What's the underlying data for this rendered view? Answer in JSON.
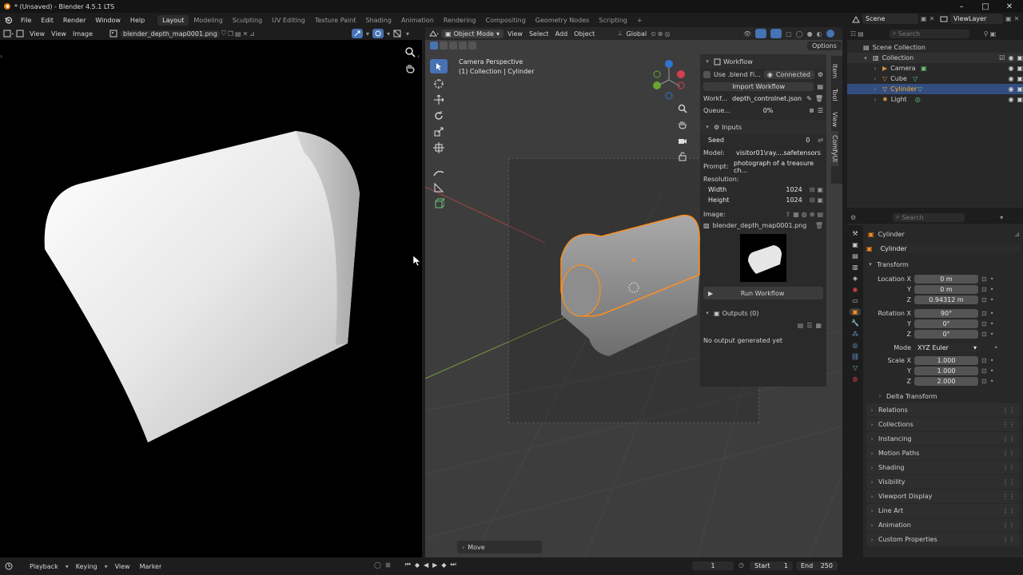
{
  "window": {
    "title": "* (Unsaved) - Blender 4.5.1 LTS",
    "min": "–",
    "max": "□",
    "close": "✕"
  },
  "menu": {
    "items": [
      "File",
      "Edit",
      "Render",
      "Window",
      "Help"
    ]
  },
  "workspaces": [
    "Layout",
    "Modeling",
    "Sculpting",
    "UV Editing",
    "Texture Paint",
    "Shading",
    "Animation",
    "Rendering",
    "Compositing",
    "Geometry Nodes",
    "Scripting",
    "+"
  ],
  "image_editor": {
    "view": "View",
    "view2": "View",
    "image": "Image",
    "filename": "blender_depth_map0001.png"
  },
  "viewport": {
    "mode": "Object Mode",
    "menus": [
      "View",
      "Select",
      "Add",
      "Object"
    ],
    "orientation": "Global",
    "overlay_title": "Camera Perspective",
    "overlay_sub": "(1) Collection | Cylinder",
    "options": "Options",
    "last_op": "Move",
    "side_tabs": [
      "Item",
      "Tool",
      "View",
      "ComfyUI"
    ]
  },
  "comfy": {
    "workflow_header": "Workflow",
    "use_blend": "Use .blend Fi...",
    "connected": "Connected",
    "import": "Import Workflow",
    "workf_label": "Workf...",
    "workf_value": "depth_controlnet.json",
    "queue_label": "Queue...",
    "queue_pct": "0%",
    "queue_progress": 0,
    "inputs_header": "Inputs",
    "seed_label": "Seed",
    "seed_value": "0",
    "model_label": "Model:",
    "model_value": "visitor01\\ray....safetensors",
    "prompt_label": "Prompt:",
    "prompt_value": "photograph of a treasure ch...",
    "res_label": "Resolution:",
    "width_label": "Width",
    "width_value": "1024",
    "height_label": "Height",
    "height_value": "1024",
    "image_label": "Image:",
    "image_file": "blender_depth_map0001.png",
    "run": "Run Workflow",
    "outputs_header": "Outputs (0)",
    "no_output": "No output generated yet"
  },
  "outliner": {
    "scene": "Scene",
    "viewlayer": "ViewLayer",
    "search_placeholder": "Search",
    "root": "Scene Collection",
    "collection": "Collection",
    "items": [
      {
        "name": "Camera"
      },
      {
        "name": "Cube"
      },
      {
        "name": "Cylinder"
      },
      {
        "name": "Light"
      }
    ]
  },
  "properties": {
    "search_placeholder": "Search",
    "object": "Cylinder",
    "data_name": "Cylinder",
    "transform": "Transform",
    "location": {
      "label": "Location X",
      "x": "0 m",
      "y": "0 m",
      "z": "0.94312 m"
    },
    "rotation": {
      "label": "Rotation X",
      "x": "90°",
      "y": "0°",
      "z": "0°"
    },
    "mode_label": "Mode",
    "mode_value": "XYZ Euler",
    "scale": {
      "label": "Scale X",
      "x": "1.000",
      "y": "1.000",
      "z": "2.000"
    },
    "axis": {
      "y": "Y",
      "z": "Z"
    },
    "delta": "Delta Transform",
    "sections": [
      "Relations",
      "Collections",
      "Instancing",
      "Motion Paths",
      "Shading",
      "Visibility",
      "Viewport Display",
      "Line Art",
      "Animation",
      "Custom Properties"
    ]
  },
  "timeline": {
    "playback": "Playback",
    "keying": "Keying",
    "view": "View",
    "marker": "Marker",
    "frame": "1",
    "start_label": "Start",
    "start": "1",
    "end_label": "End",
    "end": "250"
  },
  "colors": {
    "accent": "#4772b3",
    "selected": "#ff8e1f",
    "bg": "#1d1d1d"
  }
}
